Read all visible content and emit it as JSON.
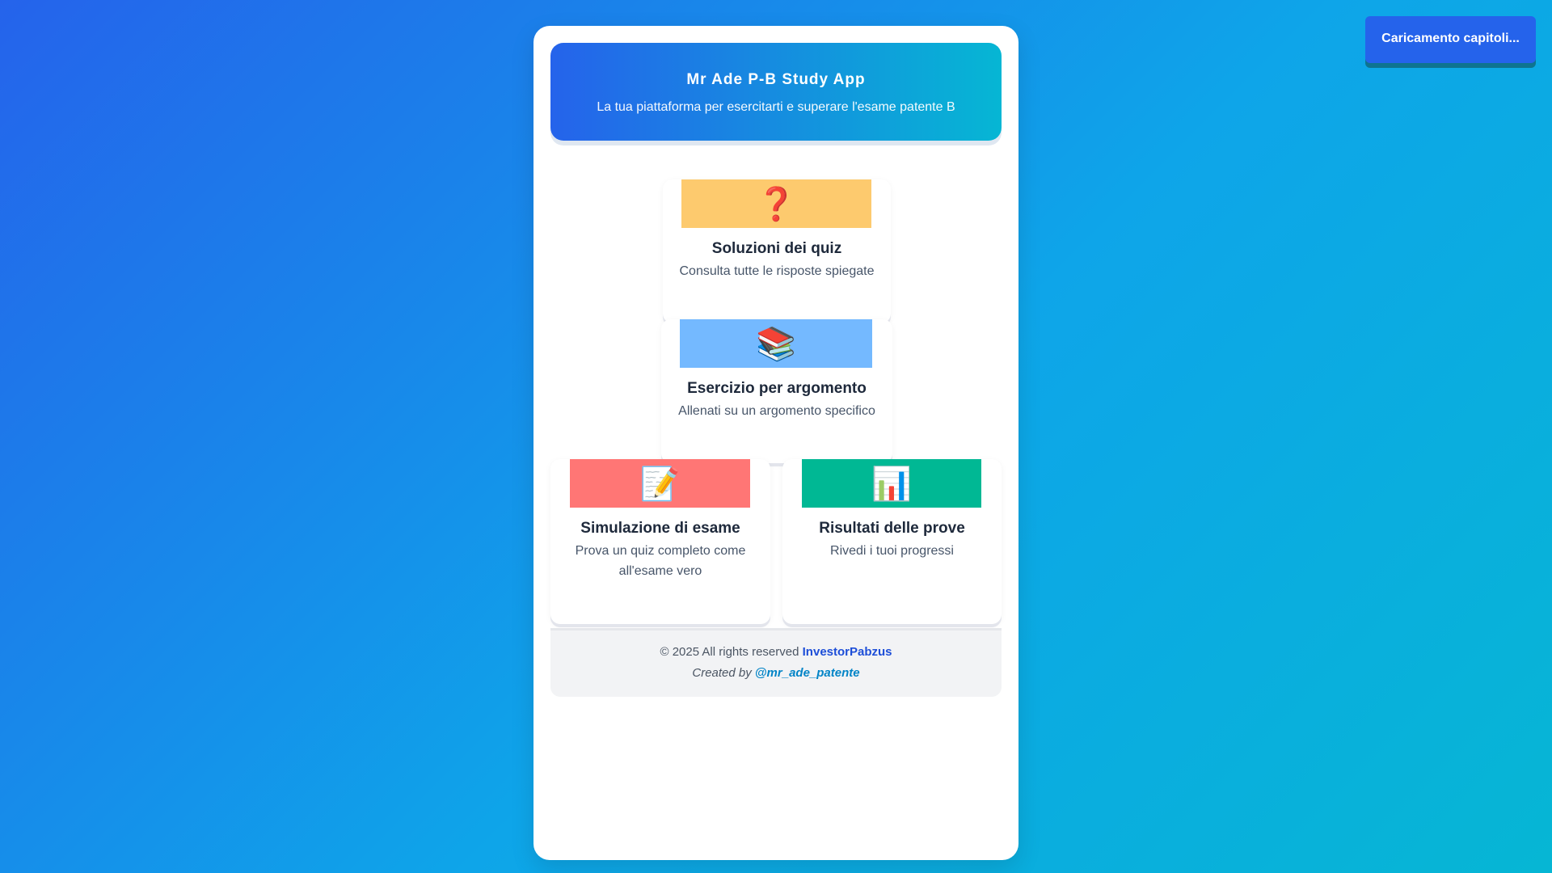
{
  "header": {
    "title": "Mr Ade P-B Study App",
    "subtitle": "La tua piattaforma per esercitarti e superare l'esame patente B"
  },
  "tiles": [
    {
      "icon": "❓",
      "icon_name": "question-mark-icon",
      "banner_color": "#fdca6e",
      "title": "Soluzioni dei quiz",
      "description": "Consulta tutte le risposte spiegate"
    },
    {
      "icon": "📚",
      "icon_name": "books-icon",
      "banner_color": "#74b9ff",
      "title": "Esercizio per argomento",
      "description": "Allenati su un argomento specifico"
    },
    {
      "icon": "📝",
      "icon_name": "memo-icon",
      "banner_color": "#ff7675",
      "title": "Simulazione di esame",
      "description": "Prova un quiz completo come all'esame vero"
    },
    {
      "icon": "📊",
      "icon_name": "bar-chart-icon",
      "banner_color": "#00b894",
      "title": "Risultati delle prove",
      "description": "Rivedi i tuoi progressi"
    }
  ],
  "footer": {
    "copyright": "© 2025 All rights reserved",
    "brand": "InvestorPabzus",
    "created_by": "Created by",
    "handle": "@mr_ade_patente"
  },
  "toast": {
    "text": "Caricamento capitoli..."
  },
  "colors": {
    "accent": "#2563eb",
    "accent_secondary": "#06b6d4"
  }
}
